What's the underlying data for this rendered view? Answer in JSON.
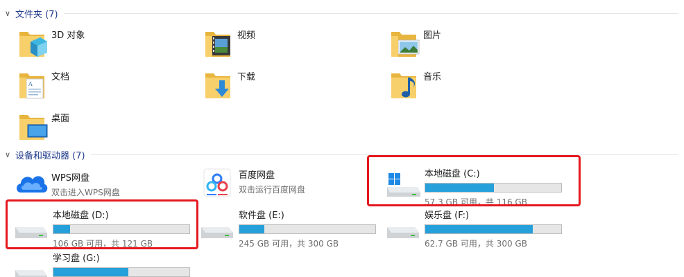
{
  "folders_group": {
    "title": "文件夹 (7)"
  },
  "folders": [
    {
      "name": "3D 对象",
      "icon": "folder-3d-objects-icon"
    },
    {
      "name": "视频",
      "icon": "folder-videos-icon"
    },
    {
      "name": "图片",
      "icon": "folder-pictures-icon"
    },
    {
      "name": "文档",
      "icon": "folder-documents-icon"
    },
    {
      "name": "下载",
      "icon": "folder-downloads-icon"
    },
    {
      "name": "音乐",
      "icon": "folder-music-icon"
    },
    {
      "name": "桌面",
      "icon": "folder-desktop-icon"
    }
  ],
  "devices_group": {
    "title": "设备和驱动器 (7)"
  },
  "apps": [
    {
      "name": "WPS网盘",
      "subtitle": "双击进入WPS网盘",
      "icon": "wps-cloud-icon"
    },
    {
      "name": "百度网盘",
      "subtitle": "双击运行百度网盘",
      "icon": "baidu-netdisk-icon"
    }
  ],
  "drives": [
    {
      "name": "本地磁盘 (C:)",
      "free_text": "57.3 GB 可用，共 116 GB",
      "used_fraction": 0.506,
      "icon": "windows-drive-icon"
    },
    {
      "name": "本地磁盘 (D:)",
      "free_text": "106 GB 可用，共 121 GB",
      "used_fraction": 0.124,
      "icon": "hard-drive-icon"
    },
    {
      "name": "软件盘 (E:)",
      "free_text": "245 GB 可用，共 300 GB",
      "used_fraction": 0.183,
      "icon": "hard-drive-icon"
    },
    {
      "name": "娱乐盘 (F:)",
      "free_text": "62.7 GB 可用，共 300 GB",
      "used_fraction": 0.791,
      "icon": "hard-drive-icon"
    },
    {
      "name": "学习盘 (G:)",
      "free_text": "",
      "used_fraction": 0.55,
      "icon": "hard-drive-icon"
    }
  ],
  "colors": {
    "highlight": "#e5171d",
    "bar_fill": "#26a0da",
    "folder": "#f3c44d",
    "group_title": "#1e3a8a"
  }
}
